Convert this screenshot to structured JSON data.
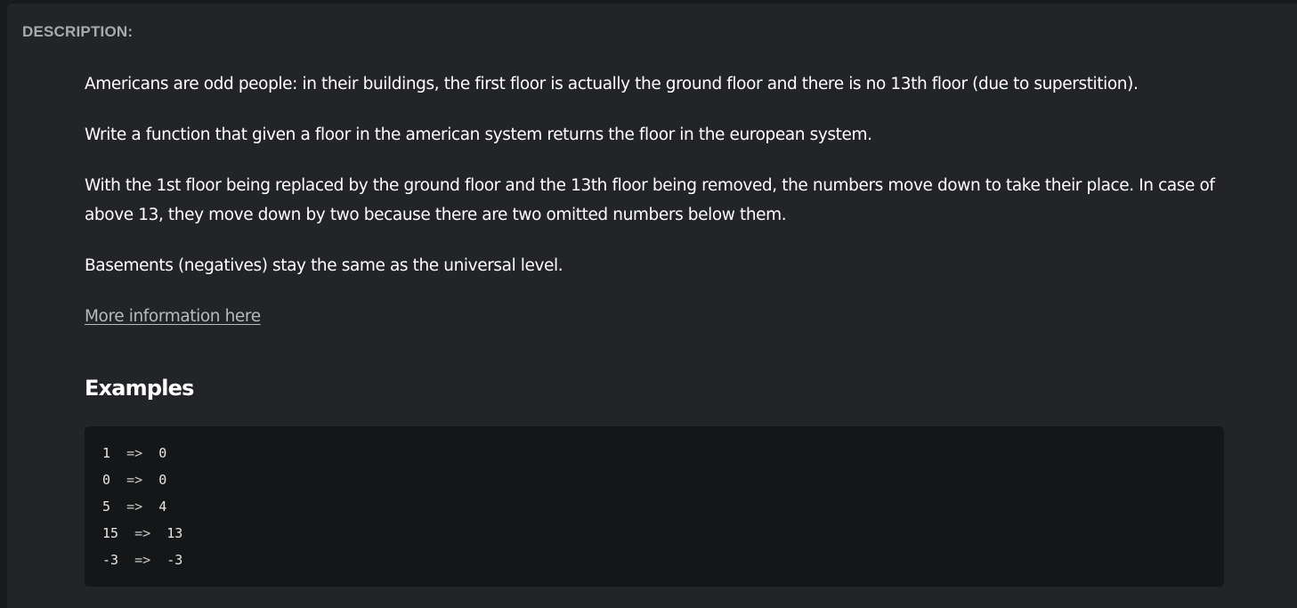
{
  "description_label": "DESCRIPTION:",
  "paragraphs": [
    "Americans are odd people: in their buildings, the first floor is actually the ground floor and there is no 13th floor (due to superstition).",
    "Write a function that given a floor in the american system returns the floor in the european system.",
    "With the 1st floor being replaced by the ground floor and the 13th floor being removed, the numbers move down to take their place. In case of above 13, they move down by two because there are two omitted numbers below them.",
    "Basements (negatives) stay the same as the universal level."
  ],
  "info_link": "More information here",
  "examples_heading": "Examples",
  "examples": [
    {
      "input": "1",
      "arrow": "=>",
      "output": "0"
    },
    {
      "input": "0",
      "arrow": "=>",
      "output": "0"
    },
    {
      "input": "5",
      "arrow": "=>",
      "output": "4"
    },
    {
      "input": "15",
      "arrow": "=>",
      "output": "13"
    },
    {
      "input": "-3",
      "arrow": "=>",
      "output": "-3"
    }
  ],
  "colors": {
    "page_background": "#181a1d",
    "panel_background": "#232428",
    "code_background": "#151617",
    "label_text": "#a8aaae",
    "body_text": "#ffffff",
    "link_text": "#b8babd"
  }
}
